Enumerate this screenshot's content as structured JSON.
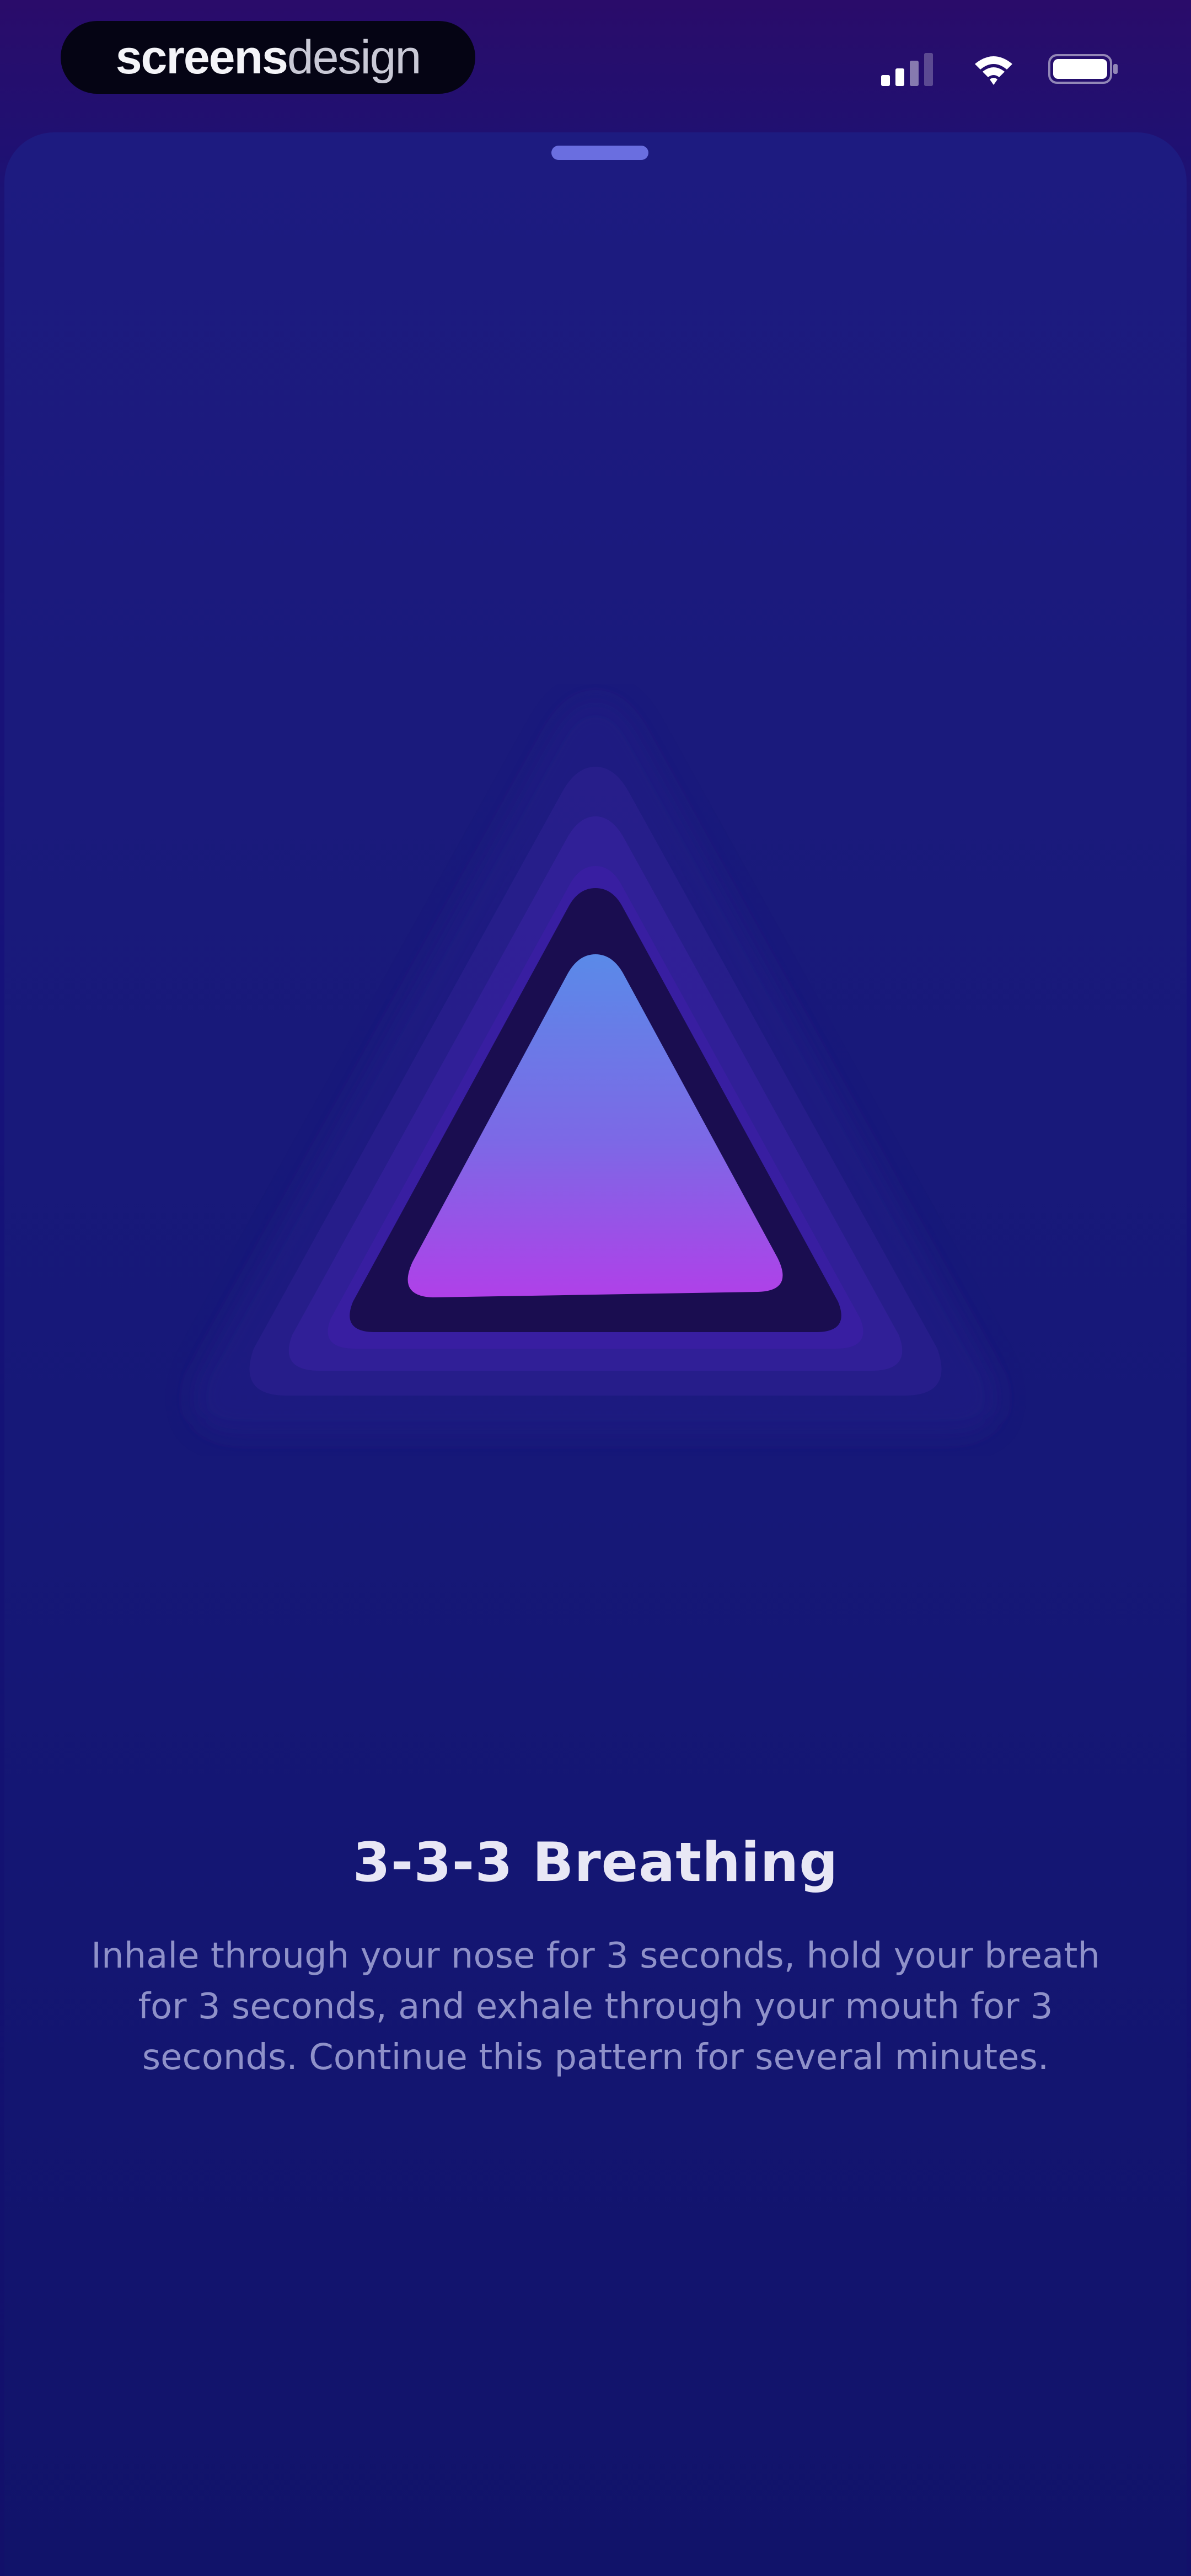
{
  "status_bar": {
    "brand": {
      "part_bold": "screens",
      "part_light": "design"
    },
    "icons": [
      "signal-icon",
      "wifi-icon",
      "battery-icon"
    ]
  },
  "sheet": {
    "grabber_icon": "grabber-handle"
  },
  "exercise": {
    "title": "3-3-3 Breathing",
    "description": "Inhale through your nose for 3 seconds, hold your breath for 3 seconds, and exhale through your mouth for 3 seconds. Continue this pattern for several minutes."
  },
  "colors": {
    "background": "#14126a",
    "sheet": "#1a1a7c",
    "triangle_gradient_top": "#5a8ae8",
    "triangle_gradient_bottom": "#a944e8",
    "triangle_ring": "#2a1f8c",
    "triangle_inner_ring": "#1a0d50",
    "title": "#e8e7f5",
    "description": "#8f91c9"
  }
}
